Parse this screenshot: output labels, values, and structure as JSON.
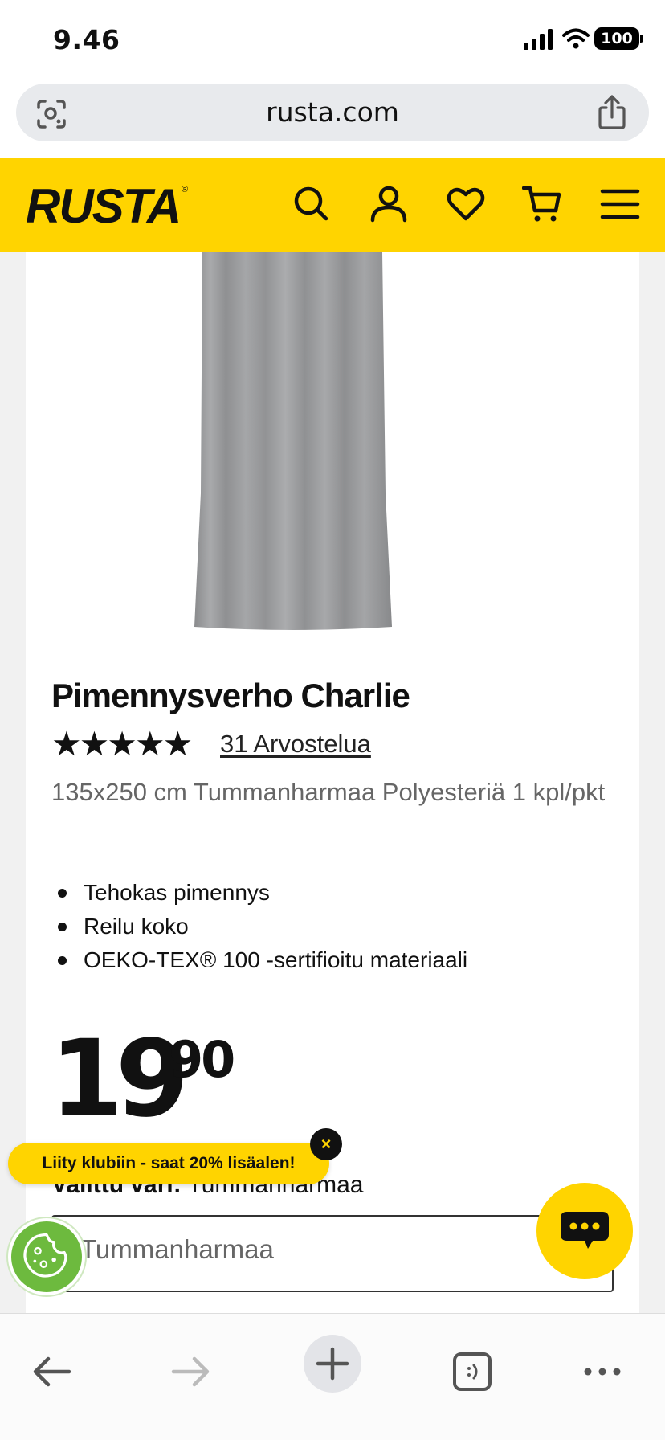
{
  "status_bar": {
    "time": "9.46",
    "battery": "100"
  },
  "browser": {
    "url": "rusta.com"
  },
  "header": {
    "logo": "RUSTA",
    "logo_mark": "®",
    "icons": [
      "search-icon",
      "account-icon",
      "heart-icon",
      "cart-icon",
      "menu-icon"
    ]
  },
  "product": {
    "title": "Pimennysverho Charlie",
    "rating": 4.7,
    "stars": "★★★★★",
    "reviews": "31 Arvostelua",
    "description": "135x250 cm Tummanharmaa Polyesteriä 1 kpl/pkt",
    "features": [
      "Tehokas pimennys",
      "Reilu koko",
      "OEKO-TEX® 100 -sertifioitu materiaali"
    ],
    "price_main": "19",
    "price_decimals": "90",
    "chosen_label": "Valittu väri:",
    "chosen_value": "Tummanharmaa",
    "select_value": "Tummanharmaa"
  },
  "promo": {
    "text": "Liity klubiin - saat 20% lisäalen!",
    "close": "×"
  },
  "colors": {
    "brand_yellow": "#ffd400",
    "cookie_green": "#6dba3e",
    "url_bar": "#e8eaed"
  },
  "toolbar": {
    "icons": [
      "back-icon",
      "forward-icon",
      "new-tab-icon",
      "tabs-icon",
      "more-icon"
    ]
  }
}
